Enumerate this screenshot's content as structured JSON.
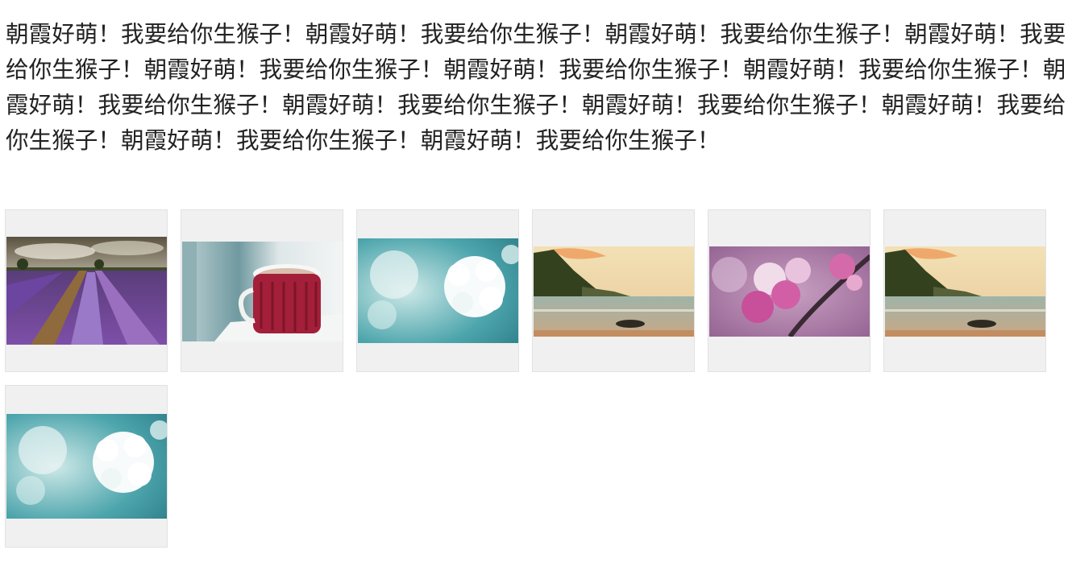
{
  "intro_text": "朝霞好萌！我要给你生猴子！朝霞好萌！我要给你生猴子！朝霞好萌！我要给你生猴子！朝霞好萌！我要给你生猴子！朝霞好萌！我要给你生猴子！朝霞好萌！我要给你生猴子！朝霞好萌！我要给你生猴子！朝霞好萌！我要给你生猴子！朝霞好萌！我要给你生猴子！朝霞好萌！我要给你生猴子！朝霞好萌！我要给你生猴子！朝霞好萌！我要给你生猴子！朝霞好萌！我要给你生猴子！",
  "gallery": {
    "thumbnails": [
      {
        "subject": "lavender-field"
      },
      {
        "subject": "red-knit-mug"
      },
      {
        "subject": "white-blossom"
      },
      {
        "subject": "sunset-beach"
      },
      {
        "subject": "pink-cherry-blossom"
      },
      {
        "subject": "sunset-beach"
      },
      {
        "subject": "white-blossom"
      }
    ]
  }
}
